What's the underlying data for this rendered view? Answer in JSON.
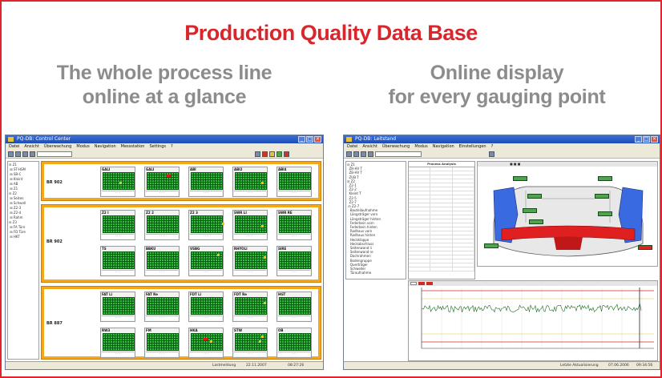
{
  "banner": {
    "title": "Production Quality Data Base",
    "left_caption_line1": "The whole process line",
    "left_caption_line2": "online at a glance",
    "right_caption_line1": "Online display",
    "right_caption_line2": "for every gauging point"
  },
  "colors": {
    "frame": "#e0262d",
    "title": "#d9262c",
    "caption": "#8c8c8c",
    "ok_green": "#2fbe3b",
    "warn_yellow": "#f2c418",
    "fail_red": "#d81c1c",
    "group_orange": "#f4a818"
  },
  "screen1": {
    "window_title": "PQ-DB: Control Center",
    "menu": [
      "Datei",
      "Ansicht",
      "Überwachung",
      "Modus",
      "Navigation",
      "Messstation",
      "Settings",
      "?"
    ],
    "groups": [
      {
        "label": "BR 902",
        "stations": [
          "GALI",
          "GALI",
          "ABI",
          "ABI2",
          "ABI4"
        ]
      },
      {
        "label": "BR 902",
        "stations": [
          "Z2 I",
          "Z2 2",
          "Z2 3",
          "SWR LI",
          "SWR RE",
          "TS",
          "BBKU",
          "VSBG",
          "RHYOLI",
          "SIRE"
        ]
      },
      {
        "label": "BR 887",
        "stations": [
          "FAT Li",
          "FAT Re",
          "FDT Li",
          "FDT Re",
          "HGT",
          "RW3",
          "FM",
          "HKA",
          "STW",
          "OB"
        ]
      }
    ],
    "status_time": "22.11.2007",
    "status_clock": "08:27:26",
    "status_label": "Lastmeldung"
  },
  "screen2": {
    "window_title": "PQ-DB: Leitstand",
    "menu": [
      "Datei",
      "Ansicht",
      "Überwachung",
      "Modus",
      "Navigation",
      "Einstellungen",
      "?"
    ],
    "table_title": "Process Analysis",
    "status_label": "Letzte Aktualisierung",
    "status_date": "07.06.2006",
    "status_clock": "09:34:56"
  }
}
